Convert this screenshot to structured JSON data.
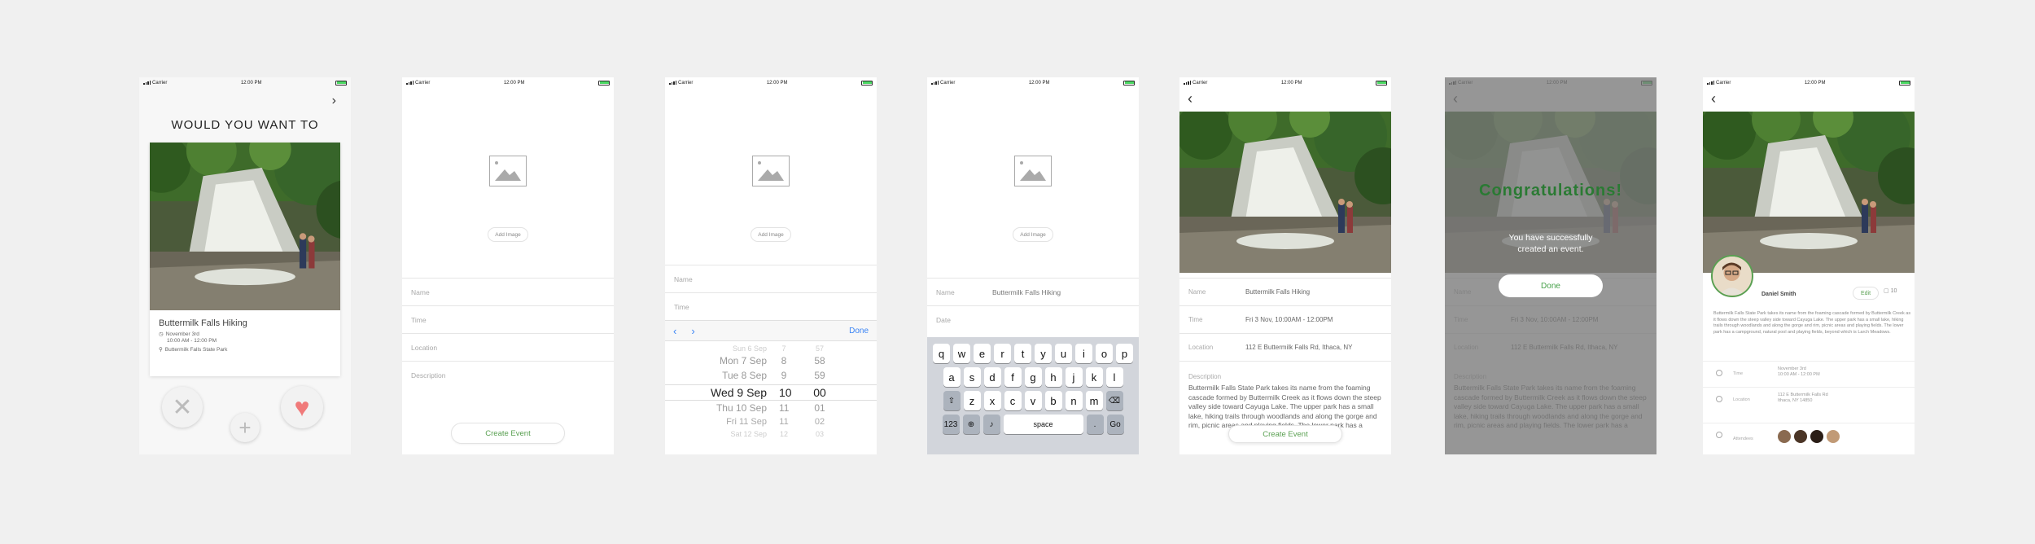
{
  "status": {
    "carrier": "Carrier",
    "time": "12:00 PM"
  },
  "swipe": {
    "title": "WOULD YOU WANT TO",
    "event_name": "Buttermilk Falls Hiking",
    "date": "November 3rd",
    "time": "10:00 AM - 12:00 PM",
    "location": "Buttermilk Falls State Park"
  },
  "form": {
    "add_image": "Add Image",
    "name_placeholder": "Name",
    "time_placeholder": "Time",
    "location_placeholder": "Location",
    "description_placeholder": "Description",
    "date_placeholder": "Date",
    "create_label": "Create Event",
    "name_value": "Buttermilk Falls Hiking"
  },
  "picker": {
    "done": "Done",
    "rows": [
      {
        "d": "Sun 6 Sep",
        "h": "7",
        "m": "57"
      },
      {
        "d": "Mon 7 Sep",
        "h": "8",
        "m": "58"
      },
      {
        "d": "Tue 8 Sep",
        "h": "9",
        "m": "59"
      },
      {
        "d": "Wed 9 Sep",
        "h": "10",
        "m": "00"
      },
      {
        "d": "Thu 10 Sep",
        "h": "11",
        "m": "01"
      },
      {
        "d": "Fri 11 Sep",
        "h": "11",
        "m": "02"
      },
      {
        "d": "Sat 12 Sep",
        "h": "12",
        "m": "03"
      }
    ]
  },
  "keyboard": {
    "row1": [
      "q",
      "w",
      "e",
      "r",
      "t",
      "y",
      "u",
      "i",
      "o",
      "p"
    ],
    "row2": [
      "a",
      "s",
      "d",
      "f",
      "g",
      "h",
      "j",
      "k",
      "l"
    ],
    "row3": [
      "z",
      "x",
      "c",
      "v",
      "b",
      "n",
      "m"
    ],
    "numbers": "123",
    "space": "space",
    "dot": ".",
    "go": "Go"
  },
  "detail": {
    "name_label": "Name",
    "name": "Buttermilk Falls Hiking",
    "time_label": "Time",
    "time": "Fri 3 Nov, 10:00AM - 12:00PM",
    "location_label": "Location",
    "location": "112 E Buttermilk Falls Rd, Ithaca, NY",
    "description_label": "Description",
    "description": "Buttermilk Falls State Park takes its name from the foaming cascade formed by Buttermilk Creek as it flows down the steep valley side toward Cayuga Lake. The upper park has a small lake, hiking trails through woodlands and along the gorge and rim, picnic areas and playing fields. The lower park has a"
  },
  "congrats": {
    "title": "Congratulations!",
    "line1": "You have successfully",
    "line2": "created an event.",
    "done": "Done"
  },
  "profile": {
    "host": "Daniel Smith",
    "edit": "Edit",
    "comments": "10",
    "description": "Buttermilk Falls State Park takes its name from the foaming cascade formed by Buttermilk Creek as it flows down the steep valley side toward Cayuga Lake. The upper park has a small lake, hiking trails through woodlands and along the gorge and rim, picnic areas and playing fields. The lower park has a campground, natural pool and playing fields, beyond which is Larch Meadows.",
    "time_label": "Time",
    "time_value_1": "November 3rd",
    "time_value_2": "10:00 AM - 12:00 PM",
    "location_label": "Location",
    "loc_value_1": "112 E Buttermilk Falls Rd",
    "loc_value_2": "Ithaca, NY 14850",
    "attendees_label": "Attendees"
  },
  "colors": {
    "accent_green": "#5aa052",
    "heart": "#f07a7a",
    "ios_blue": "#3a84f5"
  }
}
